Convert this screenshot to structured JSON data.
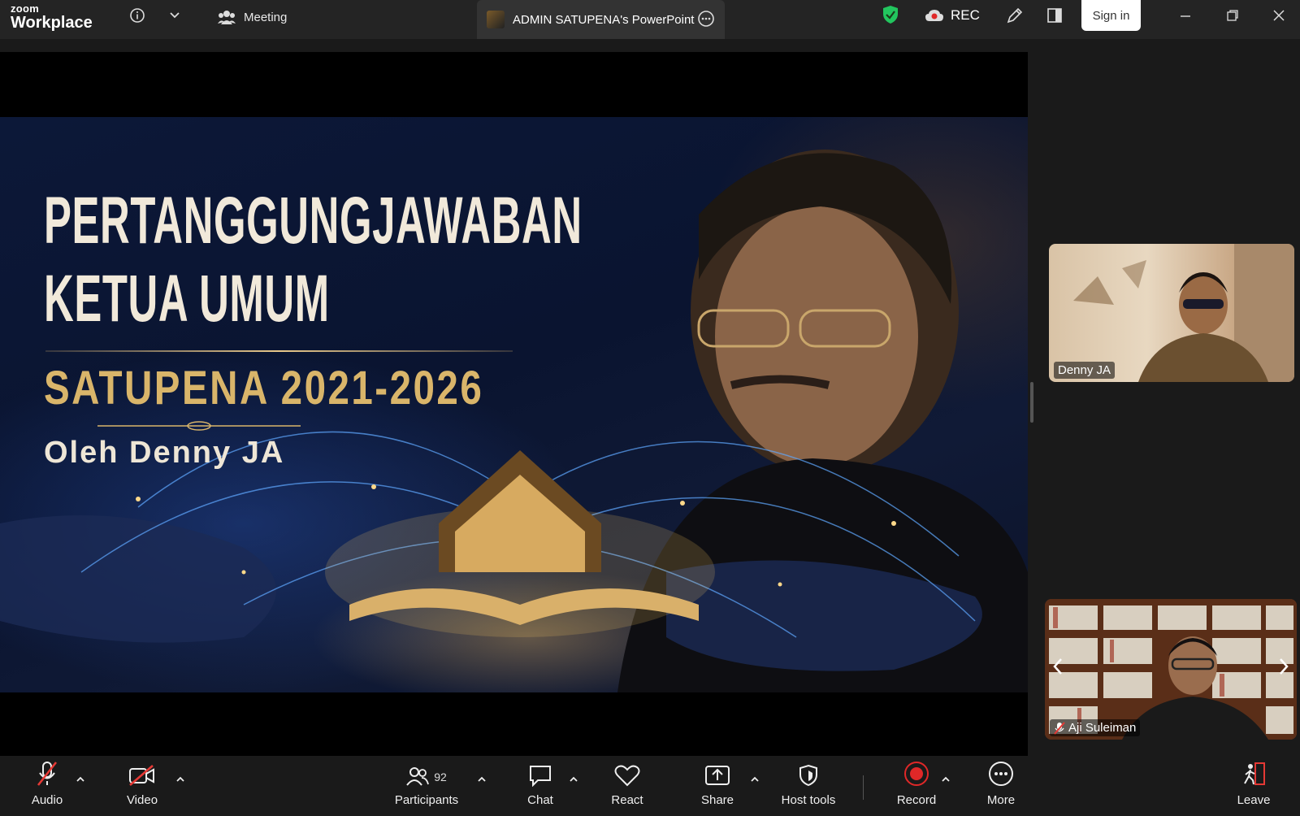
{
  "titlebar": {
    "brand_top": "zoom",
    "brand_bottom": "Workplace",
    "meeting_label": "Meeting",
    "share_title": "ADMIN SATUPENA's PowerPoint",
    "rec_label": "REC",
    "signin_label": "Sign in"
  },
  "slide": {
    "title_line1": "PERTANGGUNGJAWABAN",
    "title_line2": "KETUA UMUM",
    "subtitle": "SATUPENA 2021-2026",
    "byline": "Oleh Denny JA"
  },
  "participants_panel": {
    "tiles": [
      {
        "name": "Denny JA"
      },
      {
        "name": "Aji Suleiman",
        "muted": true
      }
    ]
  },
  "toolbar": {
    "audio": "Audio",
    "video": "Video",
    "participants": "Participants",
    "participants_count": "92",
    "chat": "Chat",
    "react": "React",
    "share": "Share",
    "host_tools": "Host tools",
    "record": "Record",
    "more": "More",
    "leave": "Leave"
  },
  "colors": {
    "record_red": "#e02828",
    "shield_green": "#22c55e",
    "muted_red": "#e53935"
  }
}
